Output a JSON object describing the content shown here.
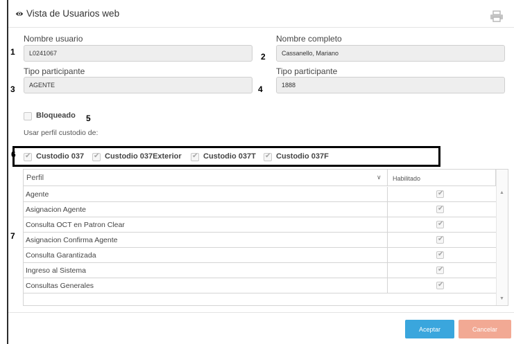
{
  "header": {
    "title": "Vista de Usuarios web",
    "icons": {
      "view": "eye-icon",
      "print": "printer-icon",
      "close": "close-icon"
    },
    "close_glyph": ">"
  },
  "fields": {
    "nombre_usuario": {
      "label": "Nombre usuario",
      "value": "L0241067"
    },
    "nombre_completo": {
      "label": "Nombre completo",
      "value": "Cassanello, Mariano"
    },
    "tipo_participante_1": {
      "label": "Tipo participante",
      "value": "AGENTE"
    },
    "tipo_participante_2": {
      "label": "Tipo participante",
      "value": "1888"
    }
  },
  "markers": {
    "m1": "1",
    "m2": "2",
    "m3": "3",
    "m4": "4",
    "m5": "5",
    "m6": "6",
    "m7": "7"
  },
  "bloqueado": {
    "label": "Bloqueado",
    "checked": false
  },
  "usar_perfil_label": "Usar perfil custodio de:",
  "custodios": [
    {
      "label": "Custodio 037",
      "checked": true
    },
    {
      "label": "Custodio 037Exterior",
      "checked": true
    },
    {
      "label": "Custodio 037T",
      "checked": true
    },
    {
      "label": "Custodio 037F",
      "checked": true
    }
  ],
  "table": {
    "columns": {
      "perfil": "Perfil",
      "habilitado": "Habilitado"
    },
    "sort_glyph": "∨",
    "rows": [
      {
        "perfil": "Agente",
        "habilitado": true
      },
      {
        "perfil": "Asignacion Agente",
        "habilitado": true
      },
      {
        "perfil": "Consulta OCT en Patron Clear",
        "habilitado": true
      },
      {
        "perfil": "Asignacion Confirma Agente",
        "habilitado": true
      },
      {
        "perfil": "Consulta Garantizada",
        "habilitado": true
      },
      {
        "perfil": "Ingreso al Sistema",
        "habilitado": true
      },
      {
        "perfil": "Consultas Generales",
        "habilitado": true
      }
    ]
  },
  "buttons": {
    "aceptar": "Aceptar",
    "cancelar": "Cancelar"
  },
  "colors": {
    "accept": "#3aa6dd",
    "cancel": "#f2a994",
    "check": "#a6a6a6"
  }
}
